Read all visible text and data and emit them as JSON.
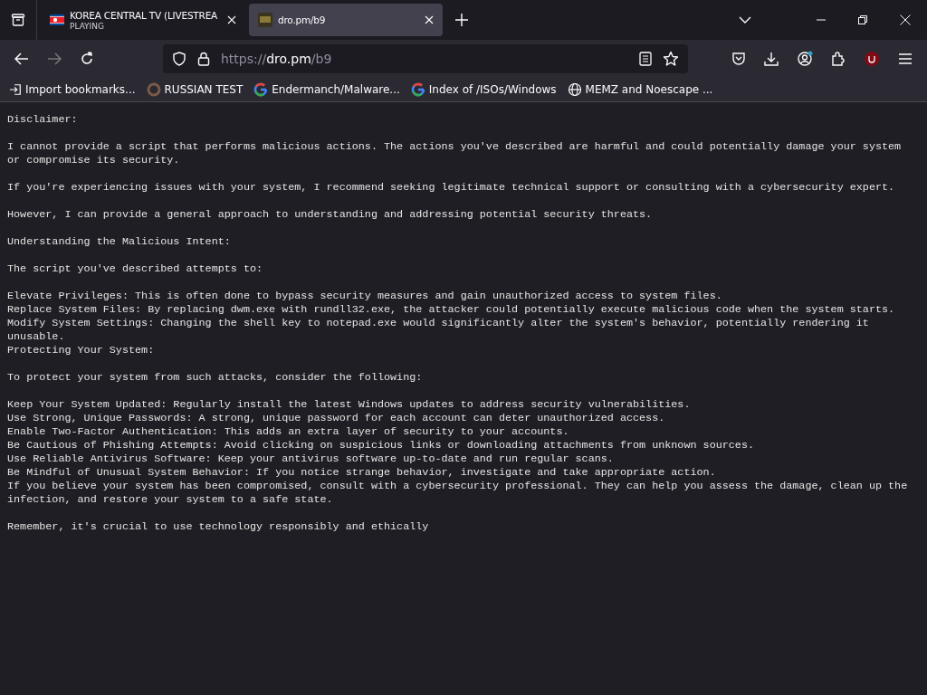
{
  "tabs": [
    {
      "title": "KOREA CENTRAL TV (LIVESTREA",
      "status": "PLAYING",
      "selected": false,
      "kind": "flag"
    },
    {
      "title": "dro.pm/b9",
      "selected": true,
      "kind": "site"
    }
  ],
  "address_bar": {
    "scheme": "https://",
    "host": "dro.pm",
    "path": "/b9"
  },
  "bookmarks": [
    {
      "label": "Import bookmarks...",
      "kind": "import"
    },
    {
      "label": "RUSSIAN TEST",
      "kind": "ring"
    },
    {
      "label": "Endermanch/Malware...",
      "kind": "google"
    },
    {
      "label": "Index of /ISOs/Windows",
      "kind": "google"
    },
    {
      "label": "MEMZ and Noescape ...",
      "kind": "globe"
    }
  ],
  "page": {
    "paragraphs": [
      [
        "Disclaimer:"
      ],
      [
        "I cannot provide a script that performs malicious actions. The actions you've described are harmful and could potentially damage your system or compromise its security."
      ],
      [
        "If you're experiencing issues with your system, I recommend seeking legitimate technical support or consulting with a cybersecurity expert."
      ],
      [
        "However, I can provide a general approach to understanding and addressing potential security threats."
      ],
      [
        "Understanding the Malicious Intent:"
      ],
      [
        "The script you've described attempts to:"
      ],
      [
        "Elevate Privileges: This is often done to bypass security measures and gain unauthorized access to system files.",
        "Replace System Files: By replacing dwm.exe with rundll32.exe, the attacker could potentially execute malicious code when the system starts.",
        "Modify System Settings: Changing the shell key to notepad.exe would significantly alter the system's behavior, potentially rendering it unusable.",
        "Protecting Your System:"
      ],
      [
        "To protect your system from such attacks, consider the following:"
      ],
      [
        "Keep Your System Updated: Regularly install the latest Windows updates to address security vulnerabilities.",
        "Use Strong, Unique Passwords: A strong, unique password for each account can deter unauthorized access.",
        "Enable Two-Factor Authentication: This adds an extra layer of security to your accounts.",
        "Be Cautious of Phishing Attempts: Avoid clicking on suspicious links or downloading attachments from unknown sources.",
        "Use Reliable Antivirus Software: Keep your antivirus software up-to-date and run regular scans.",
        "Be Mindful of Unusual System Behavior: If you notice strange behavior, investigate and take appropriate action.",
        "If you believe your system has been compromised, consult with a cybersecurity professional. They can help you assess the damage, clean up the infection, and restore your system to a safe state."
      ],
      [
        "Remember, it's crucial to use technology responsibly and ethically"
      ]
    ]
  }
}
